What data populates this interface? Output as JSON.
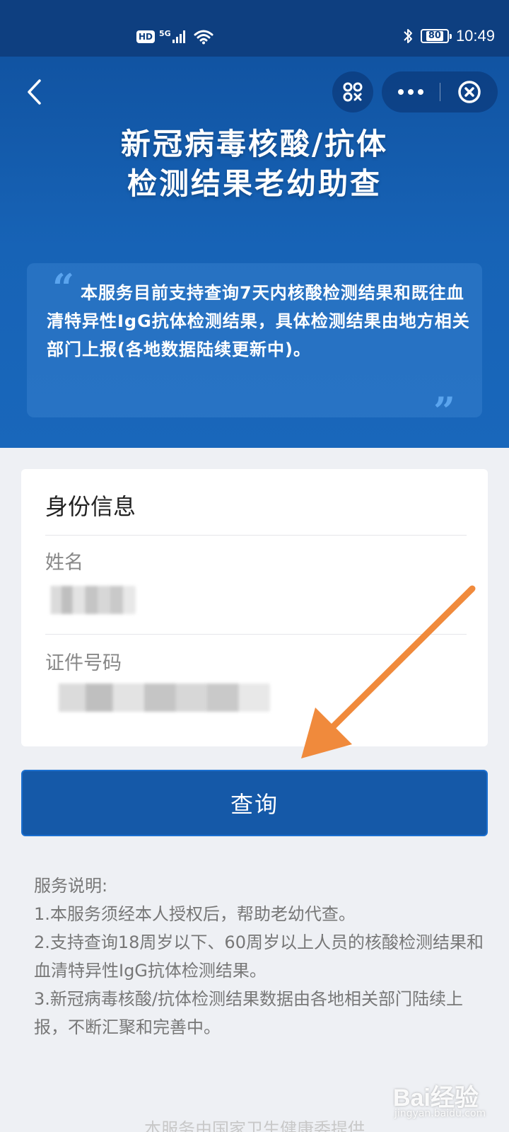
{
  "status_bar": {
    "hd_label": "HD",
    "network_label": "5G",
    "battery_level": "80",
    "time": "10:49"
  },
  "nav": {
    "back_icon": "chevron-left-icon",
    "scan_icon": "scan-icon",
    "more_icon": "more-dots-icon",
    "close_icon": "close-circle-icon"
  },
  "header": {
    "title_line1": "新冠病毒核酸/抗体",
    "title_line2": "检测结果老幼助查",
    "notice": "本服务目前支持查询7天内核酸检测结果和既往血清特异性IgG抗体检测结果，具体检测结果由地方相关部门上报(各地数据陆续更新中)。",
    "quote_open": "“",
    "quote_close": "”"
  },
  "identity": {
    "section_title": "身份信息",
    "name_label": "姓名",
    "id_label": "证件号码"
  },
  "query_button": "查询",
  "notes": {
    "heading": "服务说明:",
    "items": [
      "1.本服务须经本人授权后，帮助老幼代查。",
      "2.支持查询18周岁以下、60周岁以上人员的核酸检测结果和血清特异性IgG抗体检测结果。",
      "3.新冠病毒核酸/抗体检测结果数据由各地相关部门陆续上报，不断汇聚和完善中。"
    ]
  },
  "footer": "本服务由国家卫生健康委提供",
  "watermark": {
    "brand": "Bai经验",
    "url": "jingyan.baidu.com"
  },
  "colors": {
    "header_blue": "#1763b6",
    "status_bar": "#0e3f80",
    "button_blue": "#1559a8",
    "arrow_orange": "#f08a3c"
  }
}
